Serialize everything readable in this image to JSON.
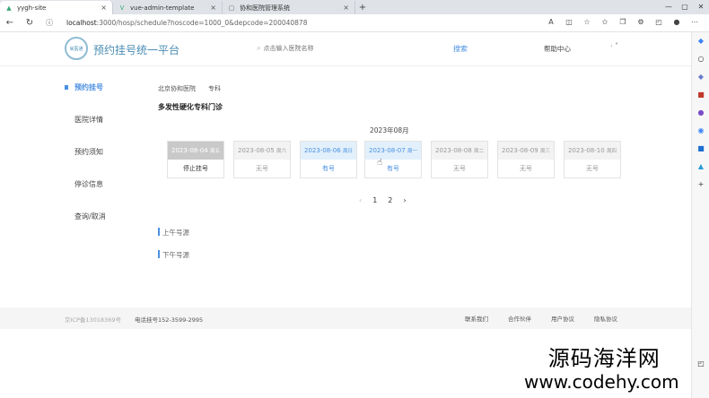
{
  "browser": {
    "tabs": [
      {
        "label": "yygh-site",
        "icon": "▲",
        "icon_color": "#3aa776"
      },
      {
        "label": "vue-admin-template",
        "icon": "V",
        "icon_color": "#3aa776"
      },
      {
        "label": "协和医院管理系统",
        "icon": "▢",
        "icon_color": "#666666"
      }
    ],
    "url_host": "localhost",
    "url_rest": ":3000/hosp/schedule?hoscode=1000_0&depcode=200040878"
  },
  "header": {
    "logo_text": "尚医通",
    "title": "预约挂号统一平台",
    "search_placeholder": "点击输入医院名称",
    "search_label": "搜索",
    "help_label": "帮助中心",
    "user_dd": "· ˅"
  },
  "sidebar": {
    "items": [
      {
        "label": "预约挂号",
        "active": true
      },
      {
        "label": "医院详情",
        "active": false
      },
      {
        "label": "预约须知",
        "active": false
      },
      {
        "label": "停诊信息",
        "active": false
      },
      {
        "label": "查询/取消",
        "active": false
      }
    ]
  },
  "main": {
    "hospital": "北京协和医院",
    "department": "专科",
    "dept_title": "多发性硬化专科门诊",
    "month": "2023年08月",
    "days": [
      {
        "date": "2023-08-04",
        "weekday": "周五",
        "status": "停止挂号",
        "state": "stopped"
      },
      {
        "date": "2023-08-05",
        "weekday": "周六",
        "status": "无号",
        "state": "none"
      },
      {
        "date": "2023-08-06",
        "weekday": "周日",
        "status": "有号",
        "state": "available"
      },
      {
        "date": "2023-08-07",
        "weekday": "周一",
        "status": "有号",
        "state": "available"
      },
      {
        "date": "2023-08-08",
        "weekday": "周二",
        "status": "无号",
        "state": "none"
      },
      {
        "date": "2023-08-09",
        "weekday": "周三",
        "status": "无号",
        "state": "none"
      },
      {
        "date": "2023-08-10",
        "weekday": "周四",
        "status": "无号",
        "state": "none"
      }
    ],
    "pager": {
      "prev": "‹",
      "pages": [
        "1",
        "2"
      ],
      "next": "›"
    },
    "morning_label": "上午号源",
    "afternoon_label": "下午号源"
  },
  "footer": {
    "icp": "京ICP备13018369号",
    "phone": "电话挂号152-3599-2995",
    "links": [
      "联系我们",
      "合作伙伴",
      "用户协议",
      "隐私协议"
    ]
  },
  "watermark": {
    "line1": "源码海洋网",
    "line2": "www.codehy.com"
  }
}
